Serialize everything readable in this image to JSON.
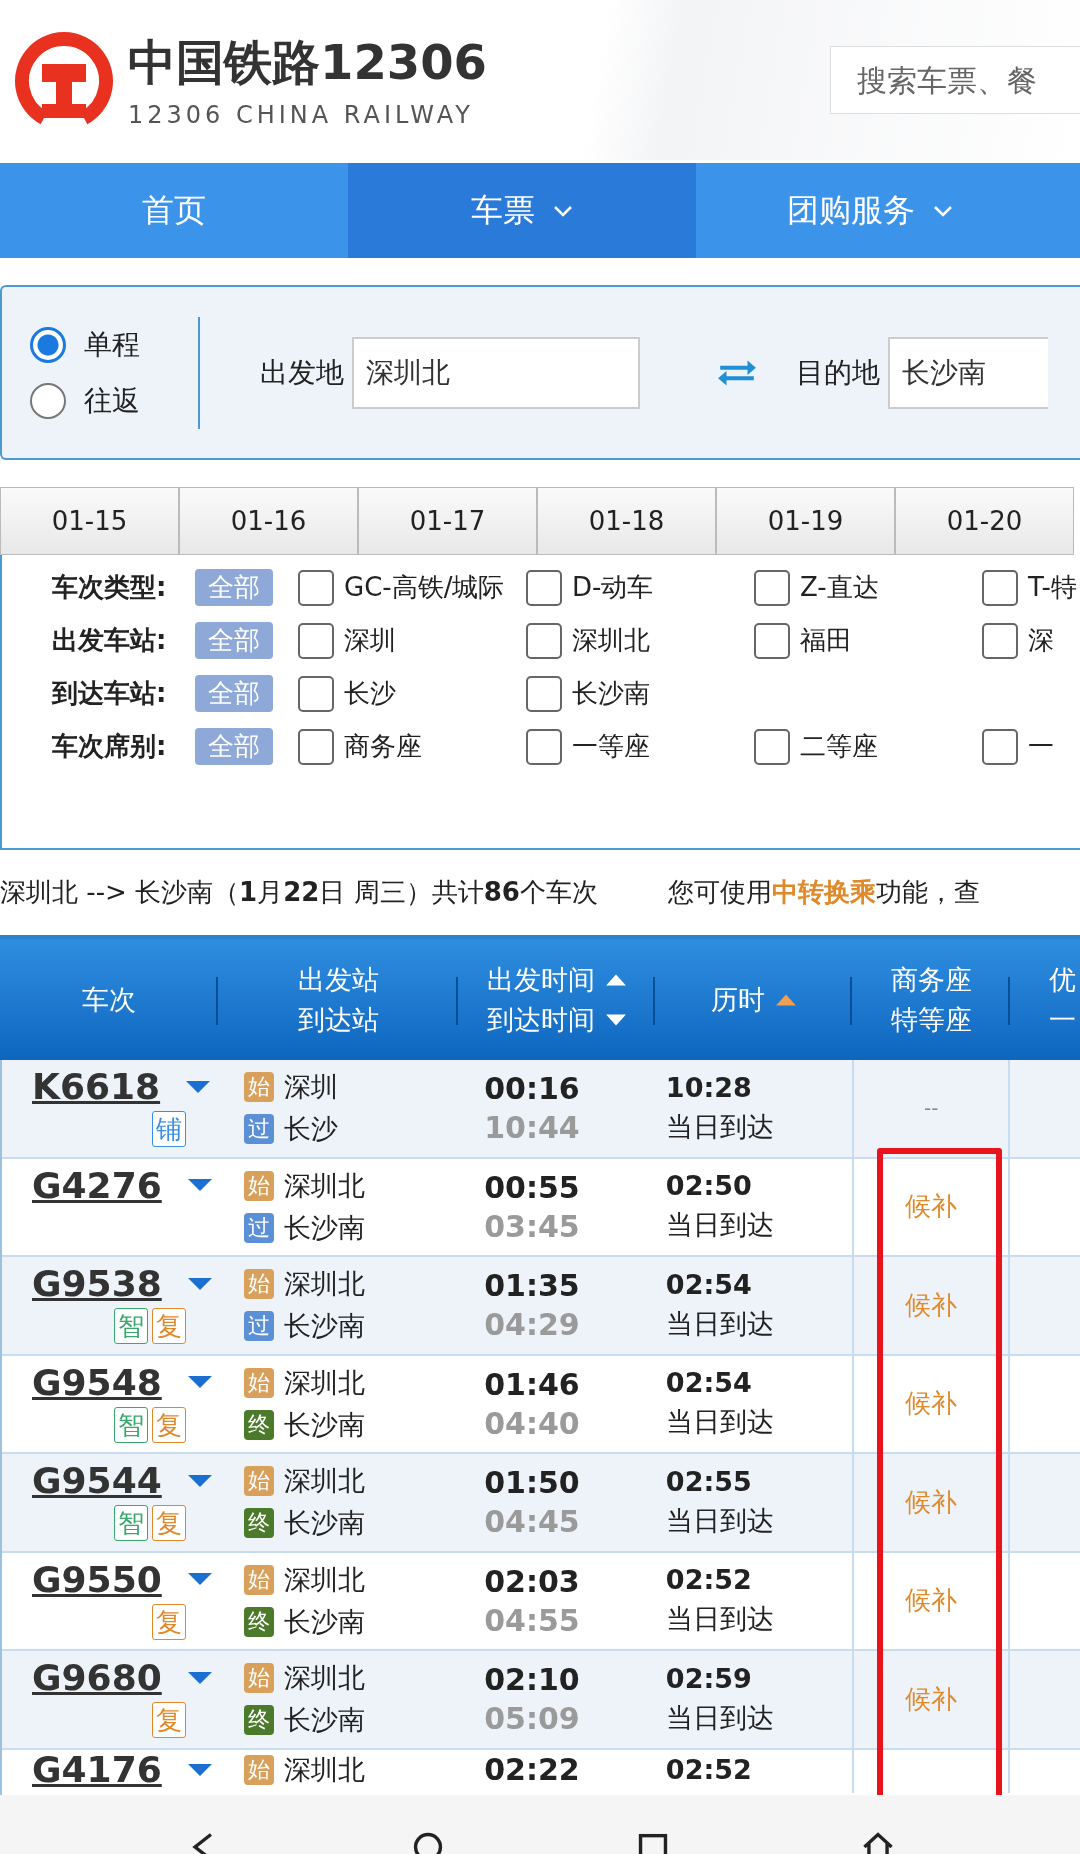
{
  "header": {
    "title": "中国铁路12306",
    "subtitle": "12306 CHINA RAILWAY",
    "search": {
      "placeholder": "搜索车票、餐"
    }
  },
  "nav": [
    {
      "label": "首页",
      "selected": false,
      "dropdown": false
    },
    {
      "label": "车票",
      "selected": true,
      "dropdown": true
    },
    {
      "label": "团购服务",
      "selected": false,
      "dropdown": true
    }
  ],
  "trip_types": [
    {
      "label": "单程",
      "selected": true
    },
    {
      "label": "往返",
      "selected": false
    }
  ],
  "from": {
    "label": "出发地",
    "value": "深圳北"
  },
  "to": {
    "label": "目的地",
    "value": "长沙南"
  },
  "dates": [
    "01-15",
    "01-16",
    "01-17",
    "01-18",
    "01-19",
    "01-20"
  ],
  "filters": [
    {
      "label": "车次类型:",
      "all": "全部",
      "options": [
        {
          "label": "GC-高铁/城际",
          "checked": false
        },
        {
          "label": "D-动车",
          "checked": false
        },
        {
          "label": "Z-直达",
          "checked": false
        },
        {
          "label": "T-特",
          "checked": false
        }
      ]
    },
    {
      "label": "出发车站:",
      "all": "全部",
      "options": [
        {
          "label": "深圳",
          "checked": false
        },
        {
          "label": "深圳北",
          "checked": false
        },
        {
          "label": "福田",
          "checked": false
        },
        {
          "label": "深",
          "checked": false
        }
      ]
    },
    {
      "label": "到达车站:",
      "all": "全部",
      "options": [
        {
          "label": "长沙",
          "checked": false
        },
        {
          "label": "长沙南",
          "checked": false
        }
      ]
    },
    {
      "label": "车次席别:",
      "all": "全部",
      "options": [
        {
          "label": "商务座",
          "checked": false
        },
        {
          "label": "一等座",
          "checked": false
        },
        {
          "label": "二等座",
          "checked": false
        },
        {
          "label": "一",
          "checked": false
        }
      ]
    }
  ],
  "summary": {
    "route": "深圳北 --> 长沙南（**1**月**22**日  周三）共计**86**个车次",
    "hint_before": "您可使用",
    "hint_link": "中转换乘",
    "hint_after": "功能，查"
  },
  "table": {
    "columns": [
      {
        "lines": [
          {
            "text": "车次"
          }
        ]
      },
      {
        "lines": [
          {
            "text": "出发站"
          },
          {
            "text": "到达站"
          }
        ]
      },
      {
        "lines": [
          {
            "text": "出发时间",
            "kind": "sortup",
            "active": false
          },
          {
            "text": "到达时间",
            "kind": "sortdown",
            "active": false
          }
        ]
      },
      {
        "lines": [
          {
            "text": "历时",
            "kind": "sortup",
            "active": true
          }
        ]
      },
      {
        "lines": [
          {
            "text": "商务座"
          },
          {
            "text": "特等座"
          }
        ]
      },
      {
        "lines": [
          {
            "text": "优"
          },
          {
            "text": "一"
          }
        ]
      }
    ],
    "rows": [
      {
        "train": "K6618",
        "tags": [
          {
            "text": "铺",
            "color": "#3a8ee6"
          }
        ],
        "from": {
          "badge": "始",
          "kind": "start",
          "name": "深圳"
        },
        "to": {
          "badge": "过",
          "kind": "pass",
          "name": "长沙"
        },
        "depart": "00:16",
        "arrive": "10:44",
        "duration": "10:28",
        "arrival_day": "当日到达",
        "business": {
          "text": "--",
          "kind": "none"
        }
      },
      {
        "train": "G4276",
        "tags": [],
        "from": {
          "badge": "始",
          "kind": "start",
          "name": "深圳北"
        },
        "to": {
          "badge": "过",
          "kind": "pass",
          "name": "长沙南"
        },
        "depart": "00:55",
        "arrive": "03:45",
        "duration": "02:50",
        "arrival_day": "当日到达",
        "business": {
          "text": "候补",
          "kind": "waitlist"
        }
      },
      {
        "train": "G9538",
        "tags": [
          {
            "text": "智",
            "color": "#3aa76d"
          },
          {
            "text": "复",
            "color": "#e0892a"
          }
        ],
        "from": {
          "badge": "始",
          "kind": "start",
          "name": "深圳北"
        },
        "to": {
          "badge": "过",
          "kind": "pass",
          "name": "长沙南"
        },
        "depart": "01:35",
        "arrive": "04:29",
        "duration": "02:54",
        "arrival_day": "当日到达",
        "business": {
          "text": "候补",
          "kind": "waitlist"
        }
      },
      {
        "train": "G9548",
        "tags": [
          {
            "text": "智",
            "color": "#3aa76d"
          },
          {
            "text": "复",
            "color": "#e0892a"
          }
        ],
        "from": {
          "badge": "始",
          "kind": "start",
          "name": "深圳北"
        },
        "to": {
          "badge": "终",
          "kind": "end",
          "name": "长沙南"
        },
        "depart": "01:46",
        "arrive": "04:40",
        "duration": "02:54",
        "arrival_day": "当日到达",
        "business": {
          "text": "候补",
          "kind": "waitlist"
        }
      },
      {
        "train": "G9544",
        "tags": [
          {
            "text": "智",
            "color": "#3aa76d"
          },
          {
            "text": "复",
            "color": "#e0892a"
          }
        ],
        "from": {
          "badge": "始",
          "kind": "start",
          "name": "深圳北"
        },
        "to": {
          "badge": "终",
          "kind": "end",
          "name": "长沙南"
        },
        "depart": "01:50",
        "arrive": "04:45",
        "duration": "02:55",
        "arrival_day": "当日到达",
        "business": {
          "text": "候补",
          "kind": "waitlist"
        }
      },
      {
        "train": "G9550",
        "tags": [
          {
            "text": "复",
            "color": "#e0892a"
          }
        ],
        "from": {
          "badge": "始",
          "kind": "start",
          "name": "深圳北"
        },
        "to": {
          "badge": "终",
          "kind": "end",
          "name": "长沙南"
        },
        "depart": "02:03",
        "arrive": "04:55",
        "duration": "02:52",
        "arrival_day": "当日到达",
        "business": {
          "text": "候补",
          "kind": "waitlist"
        }
      },
      {
        "train": "G9680",
        "tags": [
          {
            "text": "复",
            "color": "#e0892a"
          }
        ],
        "from": {
          "badge": "始",
          "kind": "start",
          "name": "深圳北"
        },
        "to": {
          "badge": "终",
          "kind": "end",
          "name": "长沙南"
        },
        "depart": "02:10",
        "arrive": "05:09",
        "duration": "02:59",
        "arrival_day": "当日到达",
        "business": {
          "text": "候补",
          "kind": "waitlist"
        }
      },
      {
        "train": "G4176",
        "tags": [],
        "from": {
          "badge": "始",
          "kind": "start",
          "name": "深圳北"
        },
        "depart": "02:22",
        "duration": "02:52"
      }
    ]
  }
}
